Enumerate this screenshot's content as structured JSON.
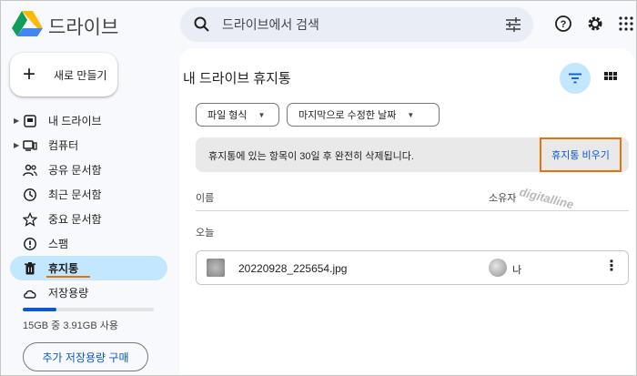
{
  "app": {
    "name": "드라이브"
  },
  "search": {
    "placeholder": "드라이브에서 검색"
  },
  "header_icons": [
    "help-icon",
    "settings-icon",
    "apps-icon"
  ],
  "sidebar": {
    "new_label": "새로 만들기",
    "items": [
      {
        "label": "내 드라이브",
        "icon": "my-drive-icon",
        "expandable": true,
        "active": false
      },
      {
        "label": "컴퓨터",
        "icon": "computer-icon",
        "expandable": true,
        "active": false
      },
      {
        "label": "공유 문서함",
        "icon": "shared-icon",
        "expandable": false,
        "active": false
      },
      {
        "label": "최근 문서함",
        "icon": "clock-icon",
        "expandable": false,
        "active": false
      },
      {
        "label": "중요 문서함",
        "icon": "star-icon",
        "expandable": false,
        "active": false
      },
      {
        "label": "스팸",
        "icon": "spam-icon",
        "expandable": false,
        "active": false
      },
      {
        "label": "휴지통",
        "icon": "trash-icon",
        "expandable": false,
        "active": true
      },
      {
        "label": "저장용량",
        "icon": "cloud-icon",
        "expandable": false,
        "active": false
      }
    ],
    "storage": {
      "text": "15GB 중 3.91GB 사용",
      "fraction": 0.26
    },
    "buy_label": "추가 저장용량 구매"
  },
  "main": {
    "title": "내 드라이브 휴지통",
    "filters": {
      "type_label": "파일 형식",
      "modified_label": "마지막으로 수정한 날짜"
    },
    "banner": {
      "text": "휴지통에 있는 항목이 30일 후 완전히 삭제됩니다.",
      "empty_label": "휴지통 비우기"
    },
    "watermark": "digitalline",
    "columns": {
      "name": "이름",
      "owner": "소유자"
    },
    "group": "오늘",
    "files": [
      {
        "name": "20220928_225654.jpg",
        "owner": "나"
      }
    ]
  },
  "colors": {
    "accent": "#0b57d0",
    "active_bg": "#c2e7ff",
    "highlight": "#e8710a"
  }
}
